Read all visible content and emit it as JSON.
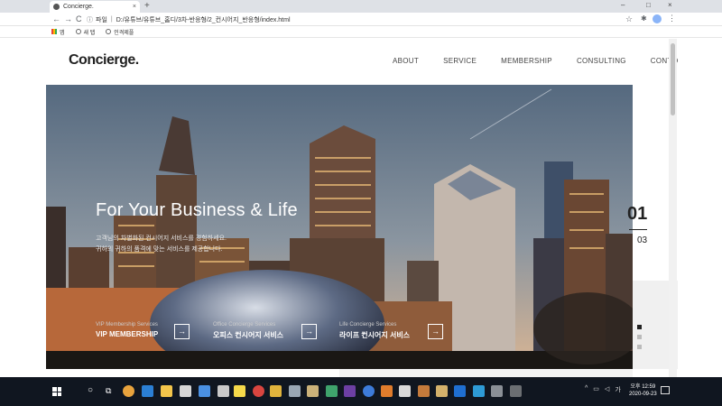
{
  "browser": {
    "tab_title": "Concierge.",
    "tab_close": "×",
    "new_tab": "+",
    "win_min": "–",
    "win_max": "□",
    "win_close": "×",
    "back": "←",
    "forward": "→",
    "reload": "C",
    "info_label": "파일",
    "url": "D:/유튜브/유튜브_홈디/3차-반응형/2_컨시어지_반응형/index.html",
    "bookmarks": [
      {
        "label": "앱",
        "icon": "apps-icon"
      },
      {
        "label": "새 탭",
        "icon": "globe-icon"
      },
      {
        "label": "인격제플",
        "icon": "globe-icon"
      }
    ]
  },
  "site": {
    "logo": "Concierge.",
    "nav": [
      "ABOUT",
      "SERVICE",
      "MEMBERSHIP",
      "CONSULTING",
      "CONTACT"
    ],
    "hero": {
      "title": "For Your Business & Life",
      "desc_line1": "고객님의 차별화된 컨시어지 서비스를 경험하세요.",
      "desc_line2": "귀하의 귀하의 품격에 맞는 서비스를 제공합니다."
    },
    "services": [
      {
        "sub": "VIP Membership Services",
        "name": "VIP MEMBERSHIP"
      },
      {
        "sub": "Office Concierge Services",
        "name": "오피스 컨시어지 서비스"
      },
      {
        "sub": "Life Concierge Services",
        "name": "라이프 컨시어지 서비스"
      }
    ],
    "arrow_glyph": "→",
    "slide_current": "01",
    "slide_total": "03"
  },
  "taskbar": {
    "time": "오후 12:59",
    "date": "2020-09-23",
    "tray_lang": "가",
    "tray_up": "^"
  },
  "colors": {
    "sky_top": "#5a6f86",
    "sky_bottom": "#d9b89a",
    "taskbar": "#101620"
  }
}
